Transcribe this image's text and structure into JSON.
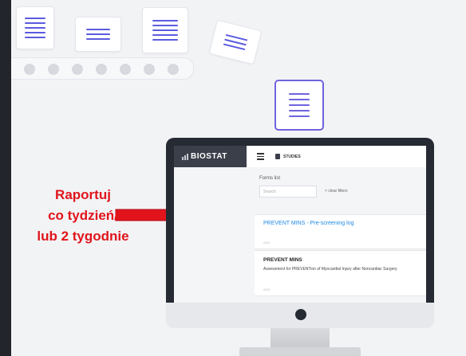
{
  "annotation": {
    "line1": "Raportuj",
    "line2": "co tydzień/",
    "line3": "lub 2 tygodnie",
    "color": "#e1141c"
  },
  "app": {
    "logo": "BIOSTAT",
    "header": {
      "menu_icon": "hamburger-icon",
      "studies_label": "STUDIES"
    },
    "forms_title": "Forms list",
    "search_placeholder": "Search",
    "clear_filters": "clear filters",
    "forms": [
      {
        "title": "PREVENT MINS - Pre-screening log",
        "subtitle": "",
        "footer": "ADD"
      },
      {
        "title": "PREVENT MINS",
        "subtitle": "Assessment for PREVENTion of Myocardial Injury after Noncardiac Surgery",
        "footer": "ADD"
      }
    ]
  },
  "colors": {
    "accent": "#6f63df",
    "link": "#1e88e5",
    "frame": "#262a33",
    "background": "#22262c"
  }
}
